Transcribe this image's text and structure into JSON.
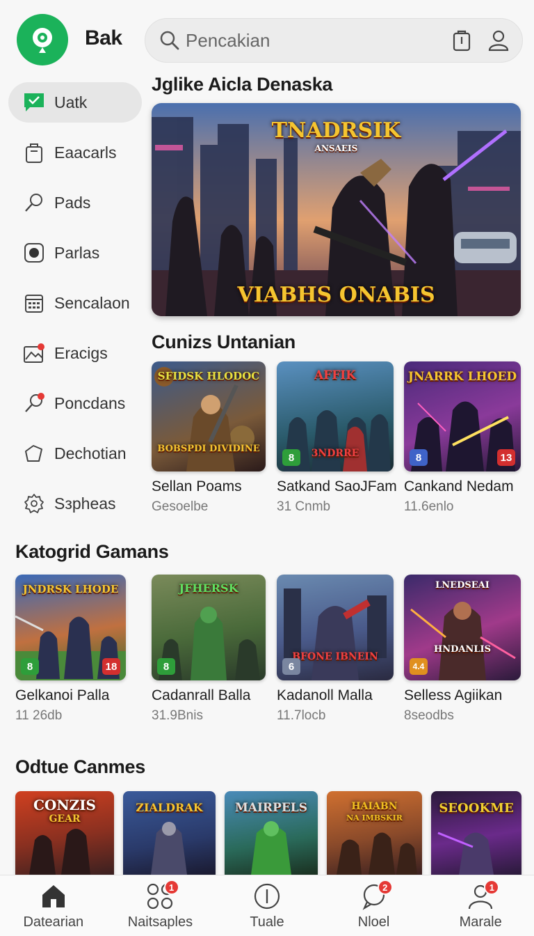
{
  "header": {
    "app_title": "Bak",
    "search_placeholder": "Pencakian"
  },
  "sidebar": {
    "items": [
      {
        "label": "Uatk",
        "icon": "message-icon",
        "active": true
      },
      {
        "label": "Eaacarls",
        "icon": "bag-icon"
      },
      {
        "label": "Pads",
        "icon": "search-icon"
      },
      {
        "label": "Parlas",
        "icon": "record-icon"
      },
      {
        "label": "Sencalaon",
        "icon": "calendar-icon"
      },
      {
        "label": "Eracigs",
        "icon": "image-icon"
      },
      {
        "label": "Poncdans",
        "icon": "tag-icon"
      },
      {
        "label": "Dechotian",
        "icon": "star-icon"
      },
      {
        "label": "Sзpheas",
        "icon": "settings-icon"
      }
    ]
  },
  "featured": {
    "section_title": "Jglike Aicla Denaska",
    "banner_title": "TNADRSIK",
    "banner_subtitle": "ANSAEIS",
    "banner_caption": "VIABHS ONABIS"
  },
  "continue": {
    "section_title": "Cunizs Untanian",
    "cards": [
      {
        "name": "Sellan Poams",
        "sub": "Gesoelbe",
        "art": "SFIDSK HLODOC",
        "art2": "BOBSPDI DIVIDINE",
        "badge_left": "",
        "badge_right": ""
      },
      {
        "name": "Satkand SaoJFam",
        "sub": "31 Cnmb",
        "art": "AFFIK",
        "art2": "3NDRRE",
        "badge_left": "8",
        "badge_right": ""
      },
      {
        "name": "Cankand Nedam",
        "sub": "11.6enlo",
        "art": "JNARRK LHOED",
        "art2": "",
        "badge_left": "8",
        "badge_right": "13"
      }
    ]
  },
  "categories": {
    "section_title": "Katogrid Gamans",
    "cards": [
      {
        "name": "Gelkanoi Palla",
        "sub": "11 26db",
        "art": "JNDRSK LHODE",
        "art2": "",
        "badge_left": "8",
        "badge_right": "18"
      },
      {
        "name": "Cadanrall Balla",
        "sub": "31.9Bnis",
        "art": "JFHERSK",
        "art2": "",
        "badge_left": "8",
        "badge_right": ""
      },
      {
        "name": "Kadanoll Malla",
        "sub": "11.7locb",
        "art": "",
        "art2": "BFONE IBNEIN",
        "badge_left": "6",
        "badge_right": ""
      },
      {
        "name": "Selless Agiikan",
        "sub": "8seodbs",
        "art": "LNEDSEAI",
        "art2": "HNDANLIS",
        "badge_left": "4.4",
        "badge_right": ""
      }
    ]
  },
  "online": {
    "section_title": "Odtue Canmes",
    "tiles": [
      {
        "art": "CONZIS",
        "art2": "GEAR"
      },
      {
        "art": "ZIALDRAK",
        "art2": ""
      },
      {
        "art": "MAIRPELS",
        "art2": ""
      },
      {
        "art": "HAIABN",
        "art2": "NA IMBSKIR"
      },
      {
        "art": "SEOOKME",
        "art2": ""
      }
    ]
  },
  "bottom_nav": [
    {
      "label": "Datearian",
      "icon": "home-icon",
      "badge": ""
    },
    {
      "label": "Naitsaples",
      "icon": "grid-icon",
      "badge": "1"
    },
    {
      "label": "Tuale",
      "icon": "clock-icon",
      "badge": ""
    },
    {
      "label": "Nloel",
      "icon": "chat-icon",
      "badge": "2"
    },
    {
      "label": "Marale",
      "icon": "profile-icon",
      "badge": "1"
    }
  ],
  "colors": {
    "accent": "#1bb25a",
    "badge_green": "#2e9e3a",
    "badge_blue": "#3f63c8",
    "badge_red": "#d32f2f",
    "badge_orange": "#e0901f",
    "notification": "#e53935"
  }
}
